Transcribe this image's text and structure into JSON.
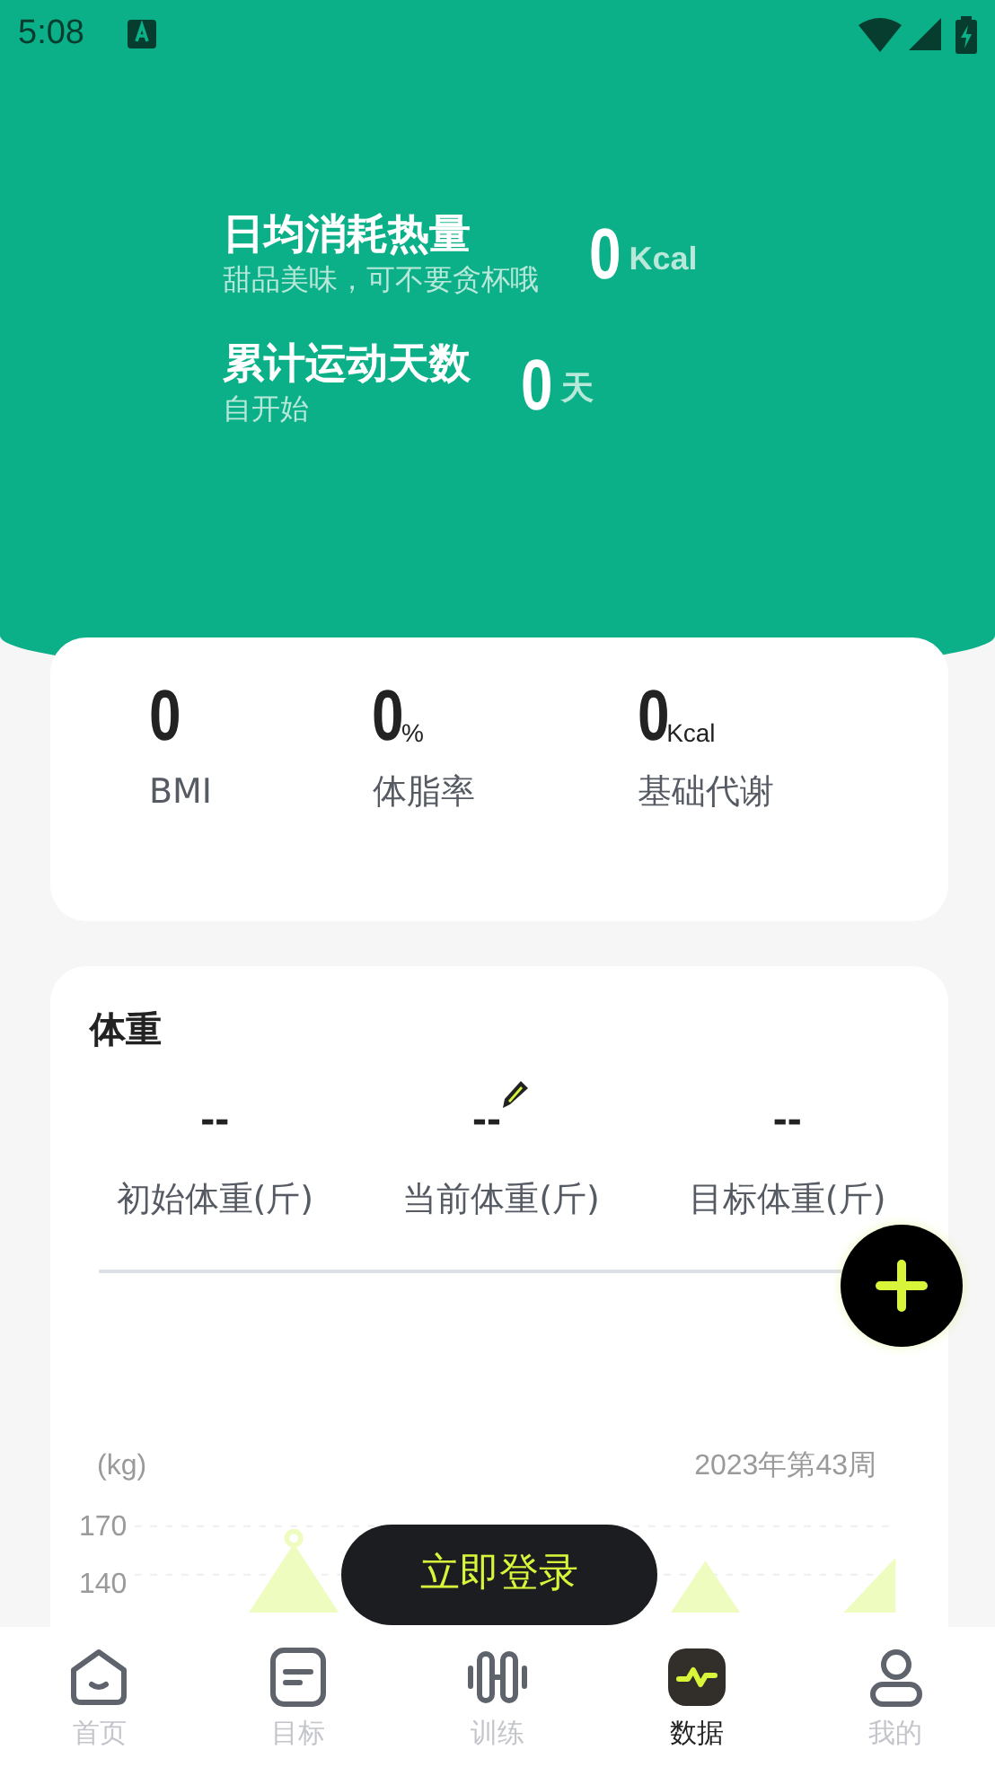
{
  "status_bar": {
    "time": "5:08"
  },
  "header": {
    "stats": [
      {
        "title": "日均消耗热量",
        "subtitle": "甜品美味，可不要贪杯哦",
        "value": "0",
        "unit": "Kcal"
      },
      {
        "title": "累计运动天数",
        "subtitle": "自开始",
        "value": "0",
        "unit": "天"
      }
    ]
  },
  "body_metrics": [
    {
      "value": "0",
      "label": "BMI"
    },
    {
      "value": "0",
      "unit": "%",
      "label": "体脂率"
    },
    {
      "value": "0",
      "unit": "Kcal",
      "label": "基础代谢"
    }
  ],
  "weight": {
    "title": "体重",
    "items": [
      {
        "value": "--",
        "label": "初始体重(斤)",
        "editable": false
      },
      {
        "value": "--",
        "label": "当前体重(斤)",
        "editable": true
      },
      {
        "value": "--",
        "label": "目标体重(斤)",
        "editable": false
      }
    ],
    "chart": {
      "unit": "(kg)",
      "period": "2023年第43周",
      "yticks": [
        "170",
        "140"
      ]
    }
  },
  "login_button": "立即登录",
  "tabs": [
    {
      "label": "首页",
      "kind": "home",
      "selected": false
    },
    {
      "label": "目标",
      "kind": "goal",
      "selected": false
    },
    {
      "label": "训练",
      "kind": "training",
      "selected": false
    },
    {
      "label": "数据",
      "kind": "data",
      "selected": true
    },
    {
      "label": "我的",
      "kind": "profile",
      "selected": false
    }
  ]
}
